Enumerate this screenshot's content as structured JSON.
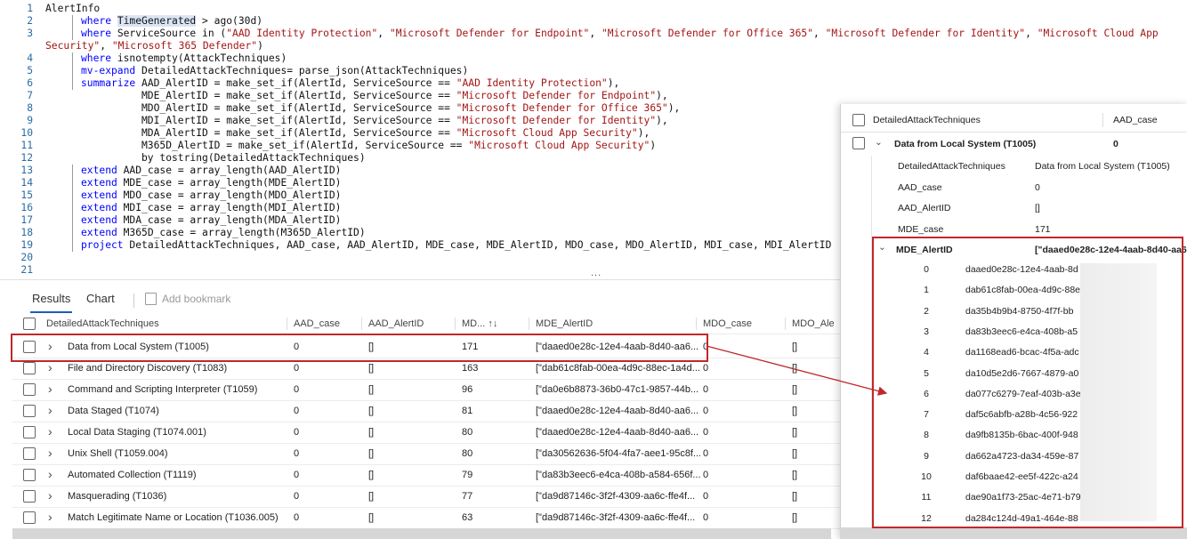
{
  "editor": {
    "lines": [
      {
        "n": "1",
        "segs": [
          [
            "t",
            "AlertInfo"
          ]
        ]
      },
      {
        "n": "2",
        "segs": [
          [
            "k",
            "where "
          ],
          [
            "h",
            "TimeGenerated"
          ],
          [
            "t",
            " > ago(30d)"
          ]
        ],
        "indent": 40,
        "bar": true
      },
      {
        "n": "3",
        "segs": [
          [
            "k",
            "where "
          ],
          [
            "t",
            "ServiceSource in ("
          ],
          [
            "s",
            "\"AAD Identity Protection\""
          ],
          [
            "t",
            ", "
          ],
          [
            "s",
            "\"Microsoft Defender for Endpoint\""
          ],
          [
            "t",
            ", "
          ],
          [
            "s",
            "\"Microsoft Defender for Office 365\""
          ],
          [
            "t",
            ", "
          ],
          [
            "s",
            "\"Microsoft Defender for Identity\""
          ],
          [
            "t",
            ", "
          ],
          [
            "s",
            "\"Microsoft Cloud App"
          ]
        ],
        "indent": 40,
        "bar": true
      },
      {
        "n": "",
        "segs": [
          [
            "s",
            "Security\""
          ],
          [
            "t",
            ", "
          ],
          [
            "s",
            "\"Microsoft 365 Defender\""
          ],
          [
            "t",
            ")"
          ]
        ],
        "indent": 0
      },
      {
        "n": "4",
        "segs": [
          [
            "k",
            "where "
          ],
          [
            "t",
            "isnotempty(AttackTechniques)"
          ]
        ],
        "indent": 40,
        "bar": true
      },
      {
        "n": "5",
        "segs": [
          [
            "k",
            "mv-expand "
          ],
          [
            "t",
            "DetailedAttackTechniques= parse_json(AttackTechniques)"
          ]
        ],
        "indent": 40,
        "bar": true
      },
      {
        "n": "6",
        "segs": [
          [
            "k",
            "summarize "
          ],
          [
            "t",
            "AAD_AlertID = make_set_if(AlertId, ServiceSource == "
          ],
          [
            "s",
            "\"AAD Identity Protection\""
          ],
          [
            "t",
            "),"
          ]
        ],
        "indent": 40,
        "bar": true
      },
      {
        "n": "7",
        "segs": [
          [
            "t",
            "MDE_AlertID = make_set_if(AlertId, ServiceSource == "
          ],
          [
            "s",
            "\"Microsoft Defender for Endpoint\""
          ],
          [
            "t",
            "),"
          ]
        ],
        "indent": 108
      },
      {
        "n": "8",
        "segs": [
          [
            "t",
            "MDO_AlertID = make_set_if(AlertId, ServiceSource == "
          ],
          [
            "s",
            "\"Microsoft Defender for Office 365\""
          ],
          [
            "t",
            "),"
          ]
        ],
        "indent": 108
      },
      {
        "n": "9",
        "segs": [
          [
            "t",
            "MDI_AlertID = make_set_if(AlertId, ServiceSource == "
          ],
          [
            "s",
            "\"Microsoft Defender for Identity\""
          ],
          [
            "t",
            "),"
          ]
        ],
        "indent": 108
      },
      {
        "n": "10",
        "segs": [
          [
            "t",
            "MDA_AlertID = make_set_if(AlertId, ServiceSource == "
          ],
          [
            "s",
            "\"Microsoft Cloud App Security\""
          ],
          [
            "t",
            "),"
          ]
        ],
        "indent": 108
      },
      {
        "n": "11",
        "segs": [
          [
            "t",
            "M365D_AlertID = make_set_if(AlertId, ServiceSource == "
          ],
          [
            "s",
            "\"Microsoft Cloud App Security\""
          ],
          [
            "t",
            ")"
          ]
        ],
        "indent": 108
      },
      {
        "n": "12",
        "segs": [
          [
            "t",
            "by tostring(DetailedAttackTechniques)"
          ]
        ],
        "indent": 108
      },
      {
        "n": "13",
        "segs": [
          [
            "k",
            "extend "
          ],
          [
            "t",
            "AAD_case = array_length(AAD_AlertID)"
          ]
        ],
        "indent": 40,
        "bar": true
      },
      {
        "n": "14",
        "segs": [
          [
            "k",
            "extend "
          ],
          [
            "t",
            "MDE_case = array_length(MDE_AlertID)"
          ]
        ],
        "indent": 40,
        "bar": true
      },
      {
        "n": "15",
        "segs": [
          [
            "k",
            "extend "
          ],
          [
            "t",
            "MDO_case = array_length(MDO_AlertID)"
          ]
        ],
        "indent": 40,
        "bar": true
      },
      {
        "n": "16",
        "segs": [
          [
            "k",
            "extend "
          ],
          [
            "t",
            "MDI_case = array_length(MDI_AlertID)"
          ]
        ],
        "indent": 40,
        "bar": true
      },
      {
        "n": "17",
        "segs": [
          [
            "k",
            "extend "
          ],
          [
            "t",
            "MDA_case = array_length(MDA_AlertID)"
          ]
        ],
        "indent": 40,
        "bar": true
      },
      {
        "n": "18",
        "segs": [
          [
            "k",
            "extend "
          ],
          [
            "t",
            "M365D_case = array_length(M365D_AlertID)"
          ]
        ],
        "indent": 40,
        "bar": true
      },
      {
        "n": "19",
        "segs": [
          [
            "k",
            "project "
          ],
          [
            "t",
            "DetailedAttackTechniques, AAD_case, AAD_AlertID, MDE_case, MDE_AlertID, MDO_case, MDO_AlertID, MDI_case, MDI_AlertID"
          ]
        ],
        "indent": 40,
        "bar": true
      },
      {
        "n": "20",
        "segs": []
      },
      {
        "n": "21",
        "segs": []
      }
    ],
    "ellipsis": "..."
  },
  "results": {
    "tabs": {
      "results": "Results",
      "chart": "Chart",
      "bookmark": "Add bookmark"
    },
    "columns": [
      "DetailedAttackTechniques",
      "AAD_case",
      "AAD_AlertID",
      "MD... ↑↓",
      "MDE_AlertID",
      "MDO_case",
      "MDO_Ale"
    ],
    "rows": [
      [
        "Data from Local System (T1005)",
        "0",
        "[]",
        "171",
        "[\"daaed0e28c-12e4-4aab-8d40-aa6...",
        "0",
        "[]"
      ],
      [
        "File and Directory Discovery (T1083)",
        "0",
        "[]",
        "163",
        "[\"dab61c8fab-00ea-4d9c-88ec-1a4d...",
        "0",
        "[]"
      ],
      [
        "Command and Scripting Interpreter (T1059)",
        "0",
        "[]",
        "96",
        "[\"da0e6b8873-36b0-47c1-9857-44b...",
        "0",
        "[]"
      ],
      [
        "Data Staged (T1074)",
        "0",
        "[]",
        "81",
        "[\"daaed0e28c-12e4-4aab-8d40-aa6...",
        "0",
        "[]"
      ],
      [
        "Local Data Staging (T1074.001)",
        "0",
        "[]",
        "80",
        "[\"daaed0e28c-12e4-4aab-8d40-aa6...",
        "0",
        "[]"
      ],
      [
        "Unix Shell (T1059.004)",
        "0",
        "[]",
        "80",
        "[\"da30562636-5f04-4fa7-aee1-95c8f...",
        "0",
        "[]"
      ],
      [
        "Automated Collection (T1119)",
        "0",
        "[]",
        "79",
        "[\"da83b3eec6-e4ca-408b-a584-656f...",
        "0",
        "[]"
      ],
      [
        "Masquerading (T1036)",
        "0",
        "[]",
        "77",
        "[\"da9d87146c-3f2f-4309-aa6c-ffe4f...",
        "0",
        "[]"
      ],
      [
        "Match Legitimate Name or Location (T1036.005)",
        "0",
        "[]",
        "63",
        "[\"da9d87146c-3f2f-4309-aa6c-ffe4f...",
        "0",
        "[]"
      ]
    ]
  },
  "panel": {
    "header": {
      "col1": "DetailedAttackTechniques",
      "col2": "AAD_case"
    },
    "group": {
      "title": "Data from Local System (T1005)",
      "value": "0"
    },
    "props": [
      [
        "DetailedAttackTechniques",
        "Data from Local System (T1005)"
      ],
      [
        "AAD_case",
        "0"
      ],
      [
        "AAD_AlertID",
        "[]"
      ],
      [
        "MDE_case",
        "171"
      ]
    ],
    "mde": {
      "key": "MDE_AlertID",
      "value": "[\"daaed0e28c-12e4-4aab-8d40-aa6"
    },
    "items": [
      [
        "0",
        "daaed0e28c-12e4-4aab-8d"
      ],
      [
        "1",
        "dab61c8fab-00ea-4d9c-88e"
      ],
      [
        "2",
        "da35b4b9b4-8750-4f7f-bb"
      ],
      [
        "3",
        "da83b3eec6-e4ca-408b-a5"
      ],
      [
        "4",
        "da1168ead6-bcac-4f5a-adc"
      ],
      [
        "5",
        "da10d5e2d6-7667-4879-a0"
      ],
      [
        "6",
        "da077c6279-7eaf-403b-a3e"
      ],
      [
        "7",
        "daf5c6abfb-a28b-4c56-922"
      ],
      [
        "8",
        "da9fb8135b-6bac-400f-948"
      ],
      [
        "9",
        "da662a4723-da34-459e-87"
      ],
      [
        "10",
        "daf6baae42-ee5f-422c-a24"
      ],
      [
        "11",
        "dae90a1f73-25ac-4e71-b79"
      ],
      [
        "12",
        "da284c124d-49a1-464e-88"
      ]
    ]
  },
  "colors": {
    "accent": "#1b5fb5",
    "highlight": "#c0282b",
    "keyword": "#0000ff",
    "string": "#a31515"
  },
  "icons": {
    "expand": "chevron-right-icon",
    "collapse": "chevron-down-icon",
    "bookmark": "bookmark-icon",
    "sort": "sort-icon"
  }
}
